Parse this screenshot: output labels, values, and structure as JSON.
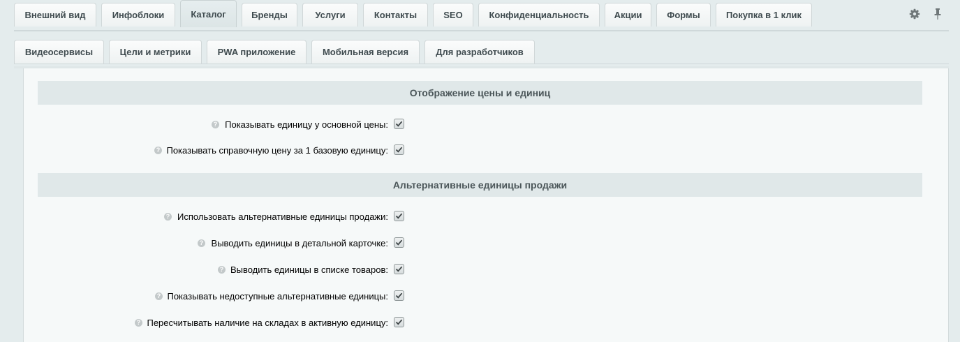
{
  "top_tabs": [
    "Внешний вид",
    "Инфоблоки",
    "Каталог",
    "Бренды",
    "Услуги",
    "Контакты",
    "SEO",
    "Конфиденциальность",
    "Акции",
    "Формы",
    "Покупка в 1 клик"
  ],
  "active_tab": "Каталог",
  "sub_tabs": [
    "Видеосервисы",
    "Цели и метрики",
    "PWA приложение",
    "Мобильная версия",
    "Для разработчиков"
  ],
  "toolbar": {
    "settings_icon": "gear-icon",
    "pin_icon": "pin-icon"
  },
  "sections": [
    {
      "title": "Отображение цены и единиц",
      "options": [
        {
          "label": "Показывать единицу у основной цены:",
          "checked": true
        },
        {
          "label": "Показывать справочную цену за 1 базовую единицу:",
          "checked": true
        }
      ]
    },
    {
      "title": "Альтернативные единицы продажи",
      "options": [
        {
          "label": "Использовать альтернативные единицы продажи:",
          "checked": true
        },
        {
          "label": "Выводить единицы в детальной карточке:",
          "checked": true
        },
        {
          "label": "Выводить единицы в списке товаров:",
          "checked": true
        },
        {
          "label": "Показывать недоступные альтернативные единицы:",
          "checked": true
        },
        {
          "label": "Пересчитывать наличие на складах в активную единицу:",
          "checked": true
        }
      ]
    }
  ],
  "help_glyph": "?"
}
